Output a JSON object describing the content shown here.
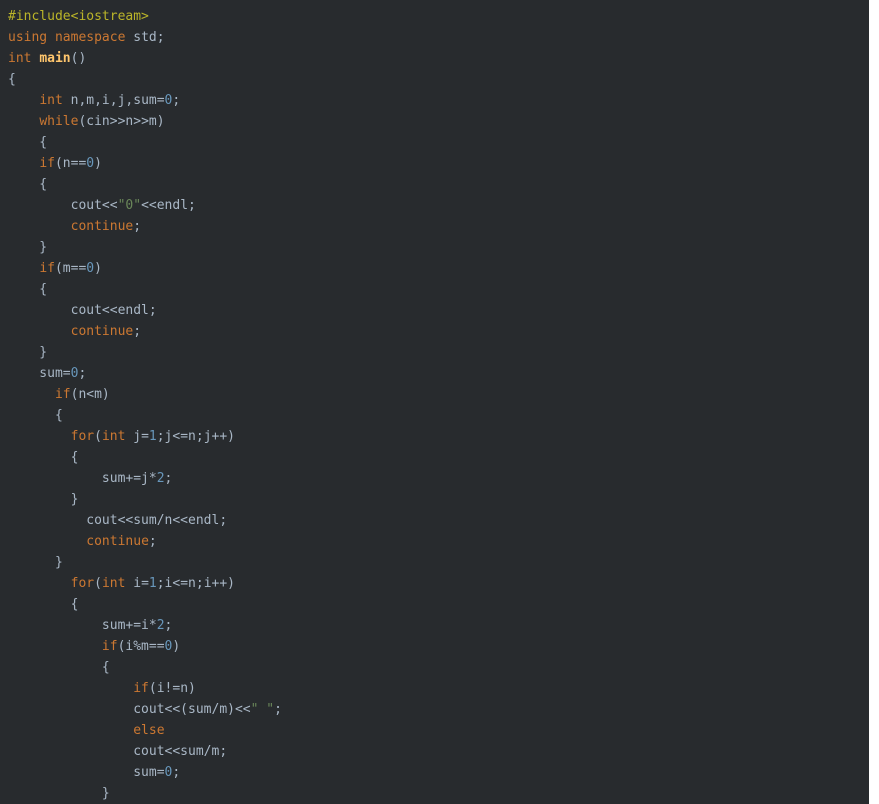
{
  "colors": {
    "background": "#282b2e",
    "default": "#a9b7c6",
    "keyword": "#cc7832",
    "function": "#ffc66d",
    "number": "#6897bb",
    "string": "#6a8759",
    "preprocessor": "#bbb529"
  },
  "code_lines": [
    [
      {
        "t": "#include<iostream>",
        "k": "pp"
      }
    ],
    [
      {
        "t": "using",
        "k": "kw"
      },
      {
        "t": " "
      },
      {
        "t": "namespace",
        "k": "kw"
      },
      {
        "t": " std;"
      }
    ],
    [
      {
        "t": "int",
        "k": "ty"
      },
      {
        "t": " "
      },
      {
        "t": "main",
        "k": "fn"
      },
      {
        "t": "()"
      }
    ],
    [
      {
        "t": "{"
      }
    ],
    [
      {
        "t": "    "
      },
      {
        "t": "int",
        "k": "ty"
      },
      {
        "t": " n,m,i,j,sum="
      },
      {
        "t": "0",
        "k": "num"
      },
      {
        "t": ";"
      }
    ],
    [
      {
        "t": "    "
      },
      {
        "t": "while",
        "k": "kw"
      },
      {
        "t": "(cin>>n>>m)"
      }
    ],
    [
      {
        "t": "    {"
      }
    ],
    [
      {
        "t": "    "
      },
      {
        "t": "if",
        "k": "kw"
      },
      {
        "t": "(n=="
      },
      {
        "t": "0",
        "k": "num"
      },
      {
        "t": ")"
      }
    ],
    [
      {
        "t": "    {"
      }
    ],
    [
      {
        "t": "        cout<<"
      },
      {
        "t": "\"0\"",
        "k": "str"
      },
      {
        "t": "<<endl;"
      }
    ],
    [
      {
        "t": "        "
      },
      {
        "t": "continue",
        "k": "kw"
      },
      {
        "t": ";"
      }
    ],
    [
      {
        "t": "    }"
      }
    ],
    [
      {
        "t": "    "
      },
      {
        "t": "if",
        "k": "kw"
      },
      {
        "t": "(m=="
      },
      {
        "t": "0",
        "k": "num"
      },
      {
        "t": ")"
      }
    ],
    [
      {
        "t": "    {"
      }
    ],
    [
      {
        "t": "        cout<<endl;"
      }
    ],
    [
      {
        "t": "        "
      },
      {
        "t": "continue",
        "k": "kw"
      },
      {
        "t": ";"
      }
    ],
    [
      {
        "t": "    }"
      }
    ],
    [
      {
        "t": "    sum="
      },
      {
        "t": "0",
        "k": "num"
      },
      {
        "t": ";"
      }
    ],
    [
      {
        "t": "      "
      },
      {
        "t": "if",
        "k": "kw"
      },
      {
        "t": "(n<m)"
      }
    ],
    [
      {
        "t": "      {"
      }
    ],
    [
      {
        "t": "        "
      },
      {
        "t": "for",
        "k": "kw"
      },
      {
        "t": "("
      },
      {
        "t": "int",
        "k": "ty"
      },
      {
        "t": " j="
      },
      {
        "t": "1",
        "k": "num"
      },
      {
        "t": ";j<=n;j++)"
      }
    ],
    [
      {
        "t": "        {"
      }
    ],
    [
      {
        "t": "            sum+=j*"
      },
      {
        "t": "2",
        "k": "num"
      },
      {
        "t": ";"
      }
    ],
    [
      {
        "t": "        }"
      }
    ],
    [
      {
        "t": "          cout<<sum/n<<endl;"
      }
    ],
    [
      {
        "t": "          "
      },
      {
        "t": "continue",
        "k": "kw"
      },
      {
        "t": ";"
      }
    ],
    [
      {
        "t": "      }"
      }
    ],
    [
      {
        "t": "        "
      },
      {
        "t": "for",
        "k": "kw"
      },
      {
        "t": "("
      },
      {
        "t": "int",
        "k": "ty"
      },
      {
        "t": " i="
      },
      {
        "t": "1",
        "k": "num"
      },
      {
        "t": ";i<=n;i++)"
      }
    ],
    [
      {
        "t": "        {"
      }
    ],
    [
      {
        "t": "            sum+=i*"
      },
      {
        "t": "2",
        "k": "num"
      },
      {
        "t": ";"
      }
    ],
    [
      {
        "t": "            "
      },
      {
        "t": "if",
        "k": "kw"
      },
      {
        "t": "(i%m=="
      },
      {
        "t": "0",
        "k": "num"
      },
      {
        "t": ")"
      }
    ],
    [
      {
        "t": "            {"
      }
    ],
    [
      {
        "t": "                "
      },
      {
        "t": "if",
        "k": "kw"
      },
      {
        "t": "(i!=n)"
      }
    ],
    [
      {
        "t": "                cout<<(sum/m)<<"
      },
      {
        "t": "\" \"",
        "k": "str"
      },
      {
        "t": ";"
      }
    ],
    [
      {
        "t": "                "
      },
      {
        "t": "else",
        "k": "kw"
      }
    ],
    [
      {
        "t": "                cout<<sum/m;"
      }
    ],
    [
      {
        "t": "                sum="
      },
      {
        "t": "0",
        "k": "num"
      },
      {
        "t": ";"
      }
    ],
    [
      {
        "t": "            }"
      }
    ]
  ]
}
